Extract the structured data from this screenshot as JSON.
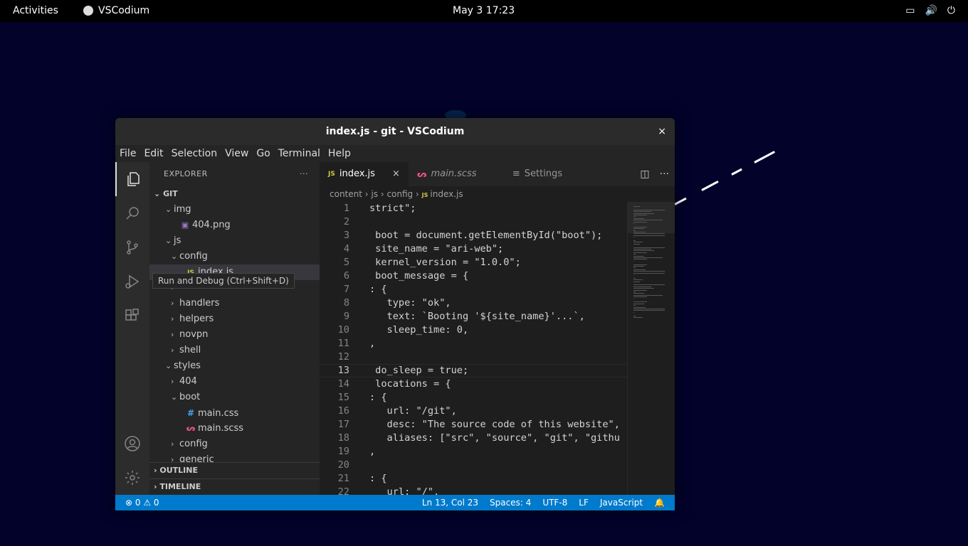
{
  "topbar": {
    "activities": "Activities",
    "app_name": "VSCodium",
    "clock": "May 3  17:23",
    "tray_icons": [
      "screen-icon",
      "volume-icon",
      "power-icon"
    ]
  },
  "window": {
    "title": "index.js - git - VSCodium",
    "close": "×"
  },
  "menu": [
    "File",
    "Edit",
    "Selection",
    "View",
    "Go",
    "Terminal",
    "Help"
  ],
  "sidebar": {
    "header": "EXPLORER",
    "more": "···",
    "section": "GIT",
    "tooltip": "Run and Debug (Ctrl+Shift+D)",
    "tree": [
      {
        "label": "img",
        "depth": 2,
        "kind": "folder-open"
      },
      {
        "label": "404.png",
        "depth": 3,
        "kind": "img"
      },
      {
        "label": "js",
        "depth": 2,
        "kind": "folder-open"
      },
      {
        "label": "config",
        "depth": 3,
        "kind": "folder-open"
      },
      {
        "label": "index.js",
        "depth": 4,
        "kind": "js",
        "selected": true
      },
      {
        "label": "",
        "depth": 3,
        "kind": "folder"
      },
      {
        "label": "handlers",
        "depth": 3,
        "kind": "folder"
      },
      {
        "label": "helpers",
        "depth": 3,
        "kind": "folder"
      },
      {
        "label": "novpn",
        "depth": 3,
        "kind": "folder"
      },
      {
        "label": "shell",
        "depth": 3,
        "kind": "folder"
      },
      {
        "label": "styles",
        "depth": 2,
        "kind": "folder-open"
      },
      {
        "label": "404",
        "depth": 3,
        "kind": "folder"
      },
      {
        "label": "boot",
        "depth": 3,
        "kind": "folder-open"
      },
      {
        "label": "main.css",
        "depth": 4,
        "kind": "css"
      },
      {
        "label": "main.scss",
        "depth": 4,
        "kind": "scss"
      },
      {
        "label": "config",
        "depth": 3,
        "kind": "folder"
      },
      {
        "label": "generic",
        "depth": 3,
        "kind": "folder"
      }
    ],
    "outline": "OUTLINE",
    "timeline": "TIMELINE"
  },
  "tabs": [
    {
      "label": "index.js",
      "icon": "JS",
      "active": true,
      "close": "×"
    },
    {
      "label": "main.scss",
      "icon": "ᔕ",
      "active": false
    },
    {
      "label": "Settings",
      "icon": "≡",
      "active": false
    }
  ],
  "breadcrumbs": [
    "content",
    "js",
    "config",
    "index.js"
  ],
  "code": [
    {
      "n": "1",
      "t": "strict\";"
    },
    {
      "n": "2",
      "t": ""
    },
    {
      "n": "3",
      "t": " boot = document.getElementById(\"boot\");"
    },
    {
      "n": "4",
      "t": " site_name = \"ari-web\";"
    },
    {
      "n": "5",
      "t": " kernel_version = \"1.0.0\";"
    },
    {
      "n": "6",
      "t": " boot_message = {"
    },
    {
      "n": "7",
      "t": ": {"
    },
    {
      "n": "8",
      "t": "   type: \"ok\","
    },
    {
      "n": "9",
      "t": "   text: `Booting '${site_name}'...`,"
    },
    {
      "n": "10",
      "t": "   sleep_time: 0,"
    },
    {
      "n": "11",
      "t": ","
    },
    {
      "n": "12",
      "t": ""
    },
    {
      "n": "13",
      "t": " do_sleep = true;",
      "current": true
    },
    {
      "n": "14",
      "t": " locations = {"
    },
    {
      "n": "15",
      "t": ": {"
    },
    {
      "n": "16",
      "t": "   url: \"/git\","
    },
    {
      "n": "17",
      "t": "   desc: \"The source code of this website\","
    },
    {
      "n": "18",
      "t": "   aliases: [\"src\", \"source\", \"git\", \"githu"
    },
    {
      "n": "19",
      "t": ","
    },
    {
      "n": "20",
      "t": ""
    },
    {
      "n": "21",
      "t": ": {"
    },
    {
      "n": "22",
      "t": "   url: \"/\","
    }
  ],
  "status": {
    "problems": "⊗ 0 ⚠ 0",
    "position": "Ln 13, Col 23",
    "spaces": "Spaces: 4",
    "encoding": "UTF-8",
    "eol": "LF",
    "language": "JavaScript",
    "bell": "🔔"
  }
}
